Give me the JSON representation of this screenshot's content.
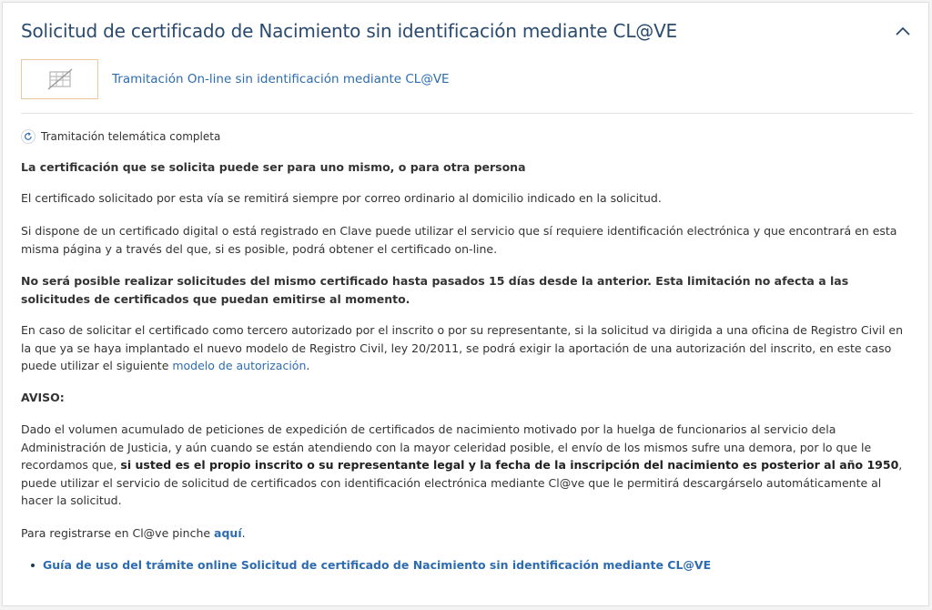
{
  "section": {
    "title": "Solicitud de certificado de Nacimiento sin identificación mediante CL@VE"
  },
  "option": {
    "icon": "card-crossed-icon",
    "link": "Tramitación On-line sin identificación mediante CL@VE"
  },
  "badge": {
    "icon": "refresh-icon",
    "label": "Tramitación telemática completa"
  },
  "body": {
    "p1": "La certificación que se solicita puede ser para uno mismo, o para otra persona",
    "p2": "El certificado solicitado por esta vía se remitirá siempre por correo ordinario al domicilio indicado en la solicitud.",
    "p3": "Si dispone de un certificado digital o está registrado en Clave puede utilizar el servicio que sí requiere identificación electrónica y que encontrará en esta misma página y a través del que, si es posible, podrá obtener el certificado on-line.",
    "p4": "No será posible realizar solicitudes del mismo certificado hasta pasados 15 días desde la anterior. Esta limitación no afecta a las solicitudes de certificados que puedan emitirse al momento.",
    "p5_text": "En caso de solicitar el certificado como tercero autorizado por el inscrito o por su representante, si la solicitud va dirigida a una oficina de Registro Civil en la que ya se haya implantado el nuevo modelo de Registro Civil, ley 20/2011, se podrá exigir la aportación de una autorización del inscrito, en este caso puede utilizar el siguiente ",
    "p5_link": "modelo de autorización",
    "p5_end": ".",
    "aviso": "AVISO:",
    "p6_a": "Dado el volumen acumulado de peticiones de expedición de certificados de nacimiento motivado por la huelga de funcionarios al servicio dela Administración de Justicia, y aún cuando se están atendiendo con la mayor celeridad posible, el envío de los mismos sufre una demora, por lo que le recordamos que, ",
    "p6_b": "si usted es el propio inscrito o su representante legal y la fecha de la inscripción del nacimiento es posterior al año 1950",
    "p6_c": ", puede utilizar el servicio de solicitud de certificados con identificación electrónica mediante Cl@ve que le permitirá descargárselo automáticamente al hacer la solicitud.",
    "p7_text": "Para registrarse en Cl@ve pinche ",
    "p7_link": "aquí",
    "p7_end": "."
  },
  "guides": [
    {
      "label": "Guía de uso del trámite online Solicitud de certificado de Nacimiento sin identificación mediante CL@VE"
    }
  ],
  "colors": {
    "title": "#2a4a6e",
    "link": "#2d6cb0",
    "icon_border": "#f0c79a"
  }
}
